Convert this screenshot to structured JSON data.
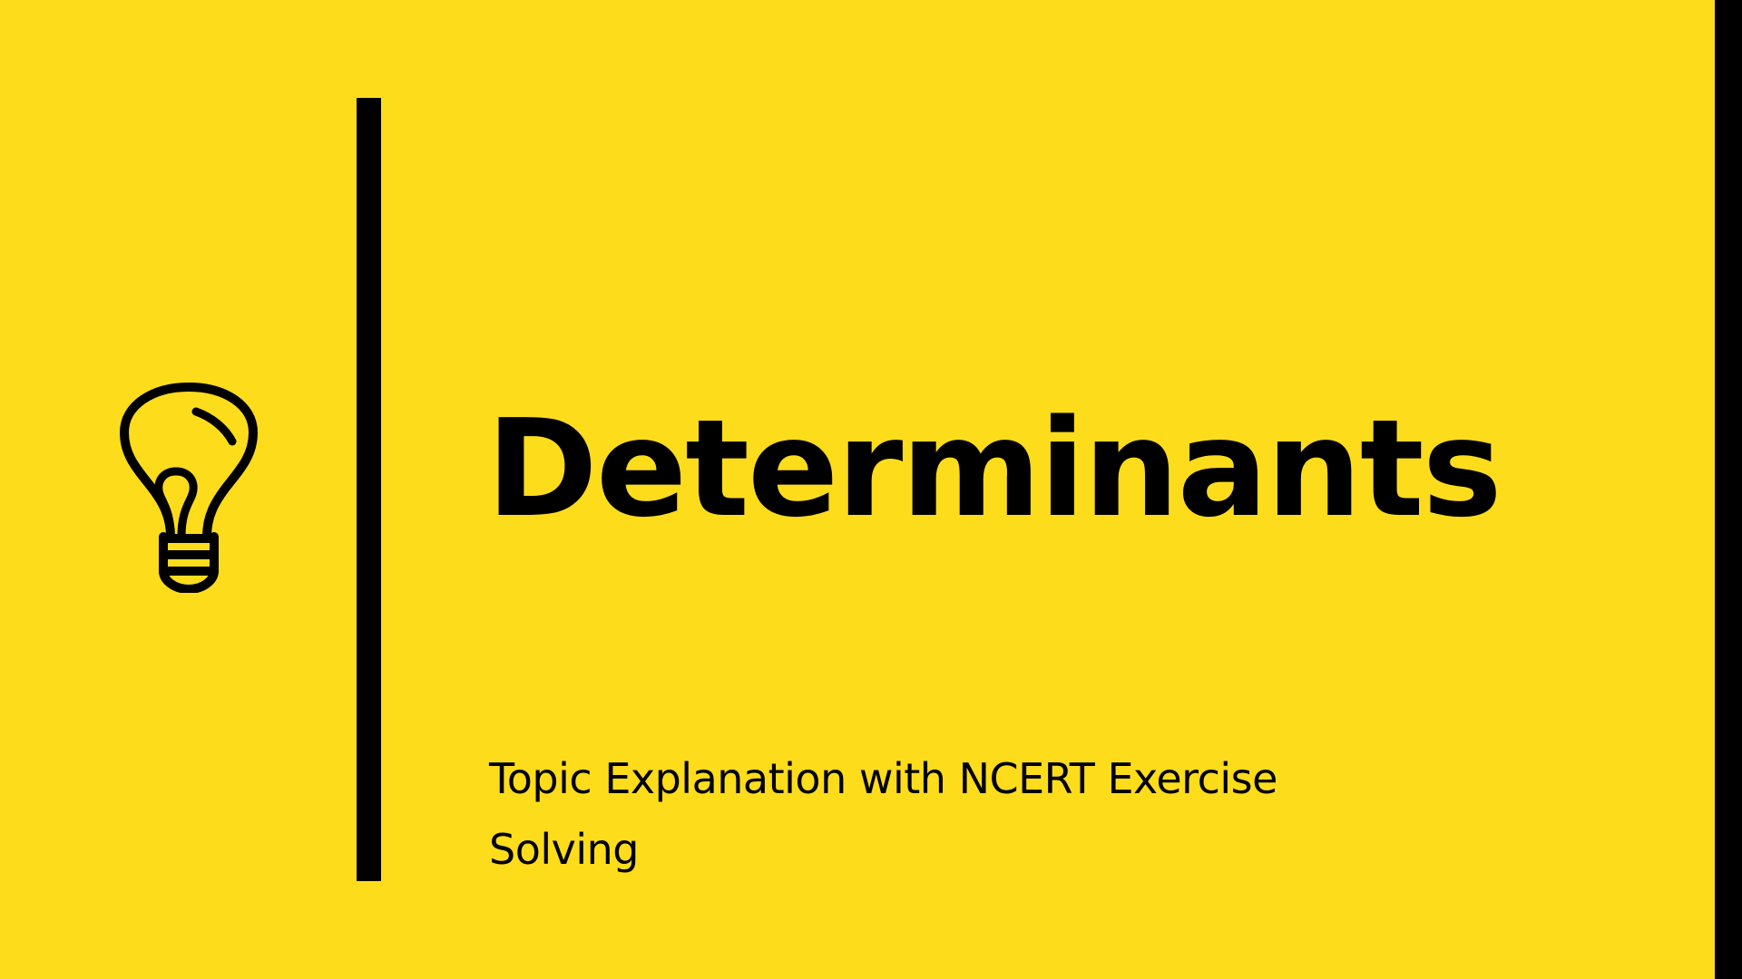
{
  "slide": {
    "title": "Determinants",
    "subtitle_lines": [
      "Topic Explanation with NCERT Exercise",
      "Solving"
    ],
    "icon": "lightbulb-icon"
  },
  "colors": {
    "background": "#fddc1c",
    "foreground": "#000000"
  }
}
